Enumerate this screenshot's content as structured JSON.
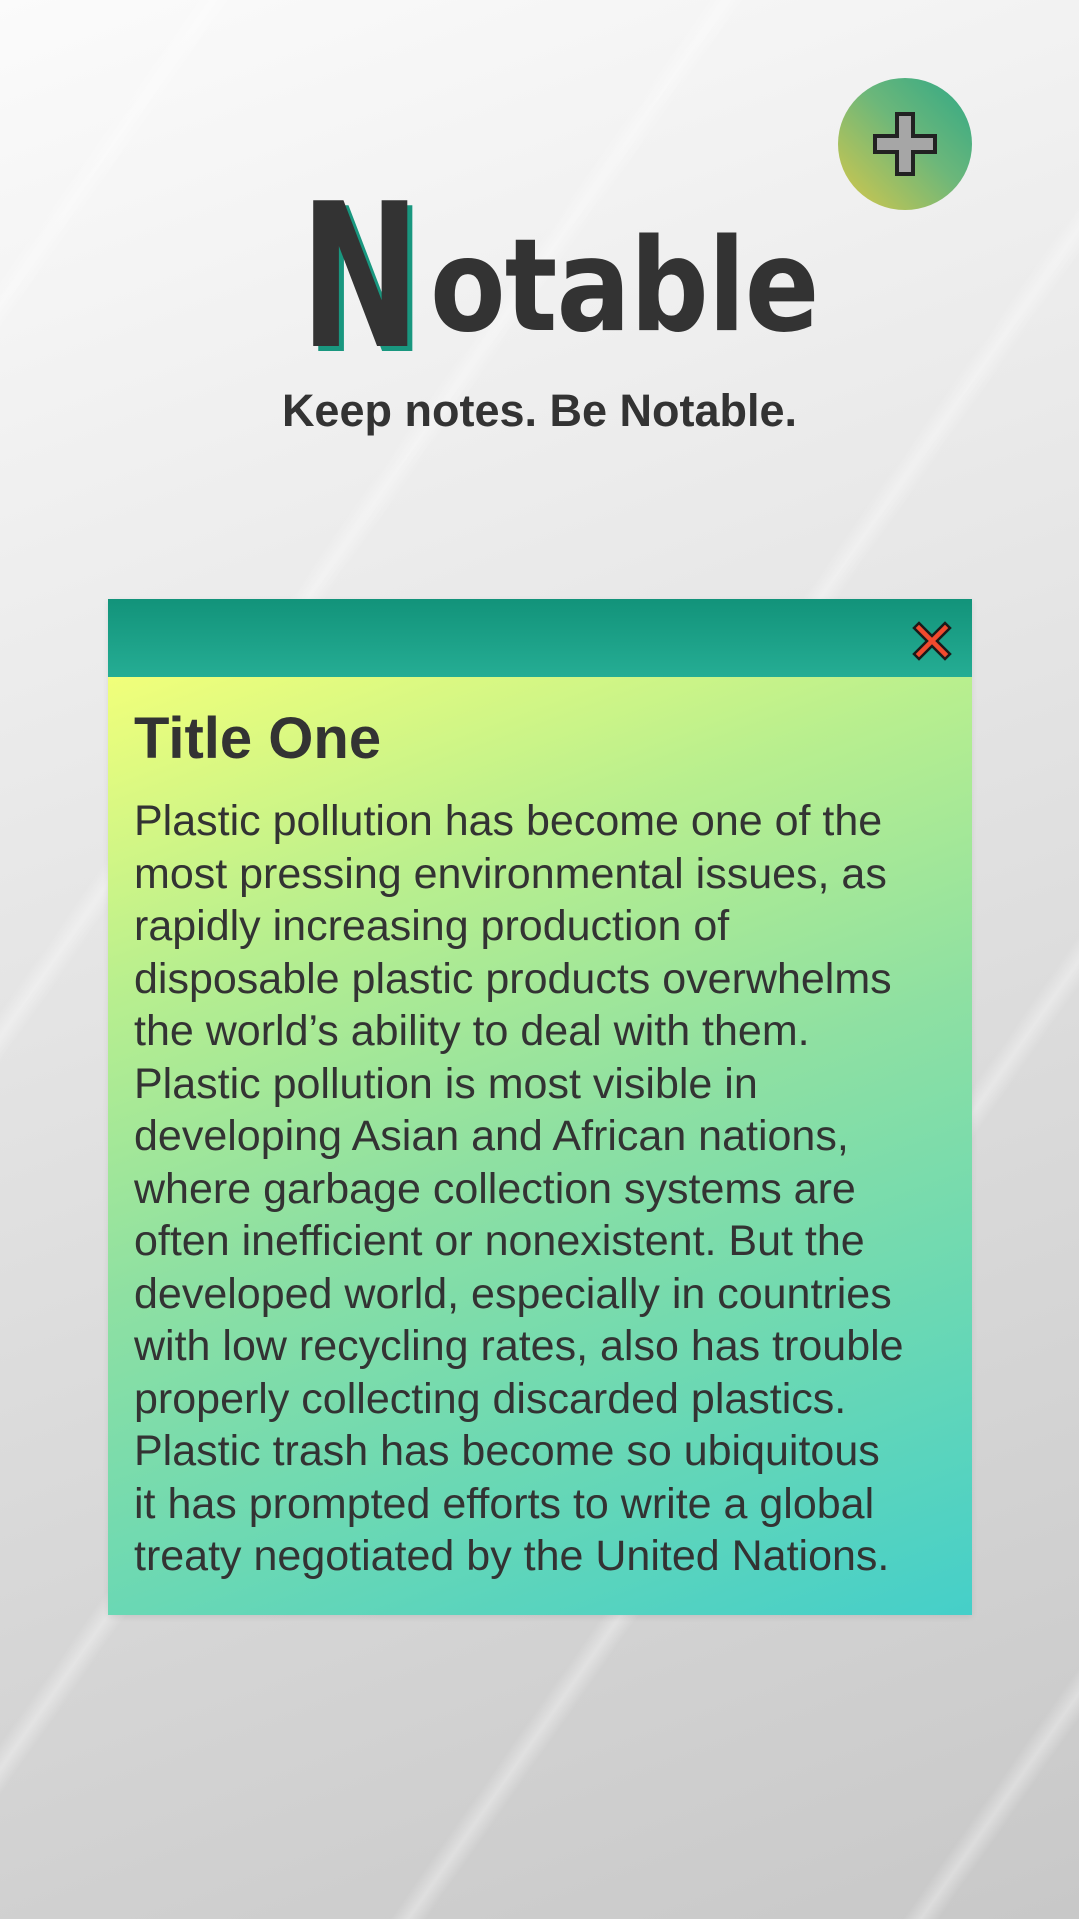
{
  "app": {
    "logo_initial": "N",
    "logo_rest": "otable",
    "tagline": "Keep notes. Be Notable."
  },
  "icons": {
    "add": "plus-icon",
    "close": "close-icon"
  },
  "colors": {
    "accent": "#19977f",
    "text": "#333333",
    "close": "#f24a2e"
  },
  "note": {
    "title": "Title One",
    "body": "Plastic pollution has become one of the\nmost pressing environmental issues, as\nrapidly increasing production of\ndisposable plastic products overwhelms\nthe world’s ability to deal with them.\nPlastic pollution is most visible in\ndeveloping Asian and African nations,\nwhere garbage collection systems are\noften inefficient or nonexistent. But the\ndeveloped world, especially in countries\nwith low recycling rates, also has trouble\nproperly collecting discarded plastics.\nPlastic trash has become so ubiquitous\nit has prompted efforts to write a global\ntreaty negotiated by the United Nations."
  }
}
